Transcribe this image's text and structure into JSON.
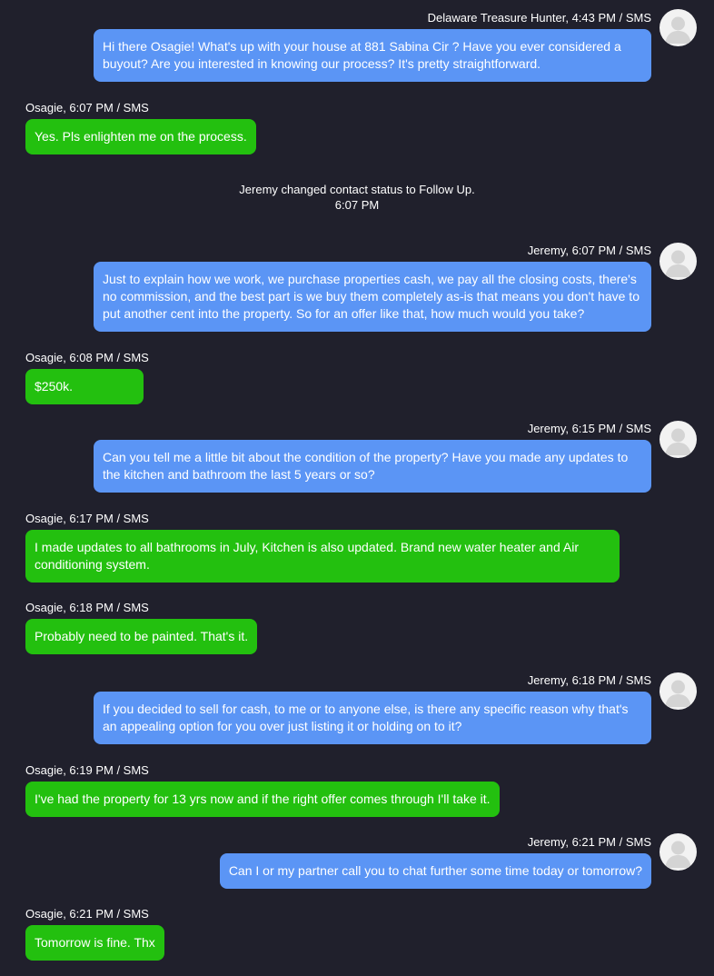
{
  "messages": [
    {
      "meta": "Delaware Treasure Hunter, 4:43 PM / SMS",
      "text": "Hi there Osagie! What's up with your house at 881 Sabina Cir ? Have you ever considered a buyout? Are you interested in knowing our process? It's pretty straightforward."
    },
    {
      "meta": "Osagie, 6:07 PM / SMS",
      "text": "Yes. Pls enlighten me on the process."
    },
    {
      "meta": "Jeremy, 6:07 PM / SMS",
      "text": "Just to explain how we work, we purchase properties cash, we pay all the closing costs, there's no commission, and the best part is we buy them completely as-is that means you don't have to put another cent into the property. So for an offer like that, how much would you take?"
    },
    {
      "meta": "Osagie, 6:08 PM / SMS",
      "text": "$250k."
    },
    {
      "meta": "Jeremy, 6:15 PM / SMS",
      "text": "Can you tell me a little bit about the condition of the property? Have you made any updates to the kitchen and bathroom the last 5 years or so?"
    },
    {
      "meta": "Osagie, 6:17 PM / SMS",
      "text": "I made updates to all bathrooms in July, Kitchen is also updated. Brand new water heater and Air conditioning system."
    },
    {
      "meta": "Osagie, 6:18 PM / SMS",
      "text": "Probably need to be painted. That's it."
    },
    {
      "meta": "Jeremy, 6:18 PM / SMS",
      "text": "If you decided to sell for cash, to me or to anyone else, is there any specific reason why that's an appealing option for you over just listing it or holding on to it?"
    },
    {
      "meta": "Osagie, 6:19 PM / SMS",
      "text": "I've had the property for 13 yrs now and if the right offer comes through I'll take it."
    },
    {
      "meta": "Jeremy, 6:21 PM / SMS",
      "text": "Can I or my partner call you to chat further some time today or tomorrow?"
    },
    {
      "meta": "Osagie, 6:21 PM / SMS",
      "text": "Tomorrow is fine. Thx"
    }
  ],
  "system_event": {
    "text": "Jeremy changed contact status to Follow Up.",
    "time": "6:07 PM"
  },
  "colors": {
    "background": "#20202c",
    "outgoing_bubble": "#5b95f5",
    "incoming_bubble": "#23c00f",
    "avatar": "#f2f2f2"
  },
  "icons": {
    "avatar": "default-user-avatar-icon"
  }
}
